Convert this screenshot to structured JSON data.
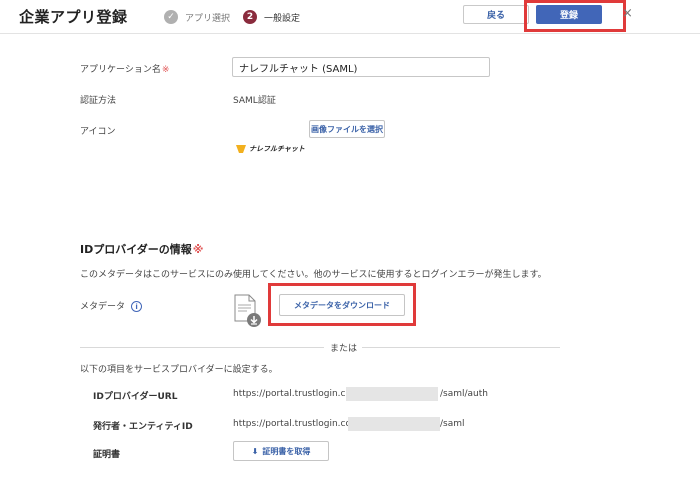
{
  "header": {
    "title": "企業アプリ登録",
    "steps": [
      {
        "number": "✓",
        "label": "アプリ選択"
      },
      {
        "number": "2",
        "label": "一般設定"
      }
    ],
    "back_label": "戻る",
    "register_label": "登録",
    "close_glyph": "×"
  },
  "form": {
    "app_name_label": "アプリケーション名",
    "required_mark": "※",
    "app_name_value": "ナレフルチャット (SAML)",
    "auth_method_label": "認証方法",
    "auth_method_value": "SAML認証",
    "icon_label": "アイコン",
    "select_image_label": "画像ファイルを選択",
    "logo_text": "ナレフルチャット"
  },
  "idp": {
    "section_title": "IDプロバイダーの情報",
    "required_mark": "※",
    "notice": "このメタデータはこのサービスにのみ使用してください。他のサービスに使用するとログインエラーが発生します。",
    "metadata_label": "メタデータ",
    "info_glyph": "i",
    "download_label": "メタデータをダウンロード",
    "or_text": "または",
    "instruction": "以下の項目をサービスプロバイダーに設定する。",
    "idp_url_label": "IDプロバイダーURL",
    "idp_url_prefix": "https://portal.trustlogin.com",
    "idp_url_suffix": "/saml/auth",
    "issuer_label": "発行者・エンティティID",
    "issuer_prefix": "https://portal.trustlogin.com/",
    "issuer_suffix": "/saml",
    "cert_label": "証明書",
    "cert_button_label": "証明書を取得"
  },
  "colors": {
    "accent": "#4166b8",
    "highlight": "#e03a3a",
    "step_active": "#8a2b3d"
  }
}
